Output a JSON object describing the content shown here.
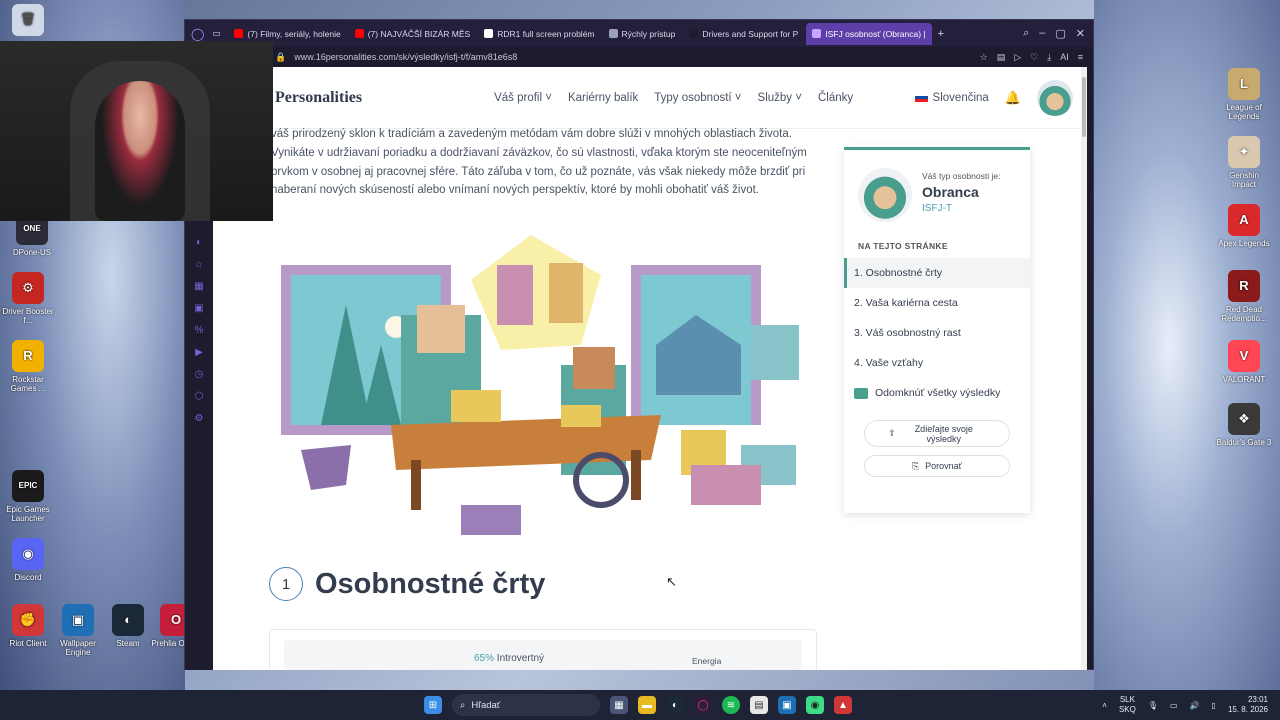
{
  "desktop": {
    "left_icons": [
      {
        "name": "DPone-US",
        "color": "#2b2b3a",
        "glyph": "ONE"
      },
      {
        "name": "Driver Booster f...",
        "color": "#c4271f",
        "glyph": "⚙"
      },
      {
        "name": "Rockstar Games ...",
        "color": "#f2b100",
        "glyph": "R"
      },
      {
        "name": "Epic Games Launcher",
        "color": "#1a1a1a",
        "glyph": "EPIC"
      },
      {
        "name": "Discord",
        "color": "#5865f2",
        "glyph": "◉"
      },
      {
        "name": "Riot Client",
        "color": "#d13639",
        "glyph": "✊"
      },
      {
        "name": "Wallpaper Engine",
        "color": "#1f6fb5",
        "glyph": "▣"
      },
      {
        "name": "Steam",
        "color": "#1b2838",
        "glyph": "◐"
      },
      {
        "name": "Prehlia Opera",
        "color": "#c41e3a",
        "glyph": "O"
      }
    ],
    "right_icons": [
      {
        "name": "League of Legends",
        "color": "#c8aa6e",
        "glyph": "L"
      },
      {
        "name": "Genshin Impact",
        "color": "#d9c7b0",
        "glyph": "✦"
      },
      {
        "name": "Apex Legends",
        "color": "#da292a",
        "glyph": "A"
      },
      {
        "name": "Red Dead Redemptio...",
        "color": "#8b1a1a",
        "glyph": "R"
      },
      {
        "name": "VALORANT",
        "color": "#ff4655",
        "glyph": "V"
      },
      {
        "name": "Baldur's Gate 3",
        "color": "#3a3a3a",
        "glyph": "❖"
      }
    ]
  },
  "browser": {
    "tabs": [
      {
        "label": "(7) Filmy, seriály, holenie",
        "fav": "#ff0000"
      },
      {
        "label": "(7) NAJVÄČŠÍ BIZÁR MĚS",
        "fav": "#ff0000"
      },
      {
        "label": "RDR1 full screen problém",
        "fav": "#ffffff"
      },
      {
        "label": "Rýchly prístup",
        "fav": "#9aa0b5"
      },
      {
        "label": "Drivers and Support for P",
        "fav": "#1d1b2e"
      },
      {
        "label": "ISFJ osobnosť (Obranca) |",
        "fav": "#c9a6ff"
      }
    ],
    "url": "www.16personalities.com/sk/výsledky/isfj-t/f/amv81e6s8"
  },
  "site": {
    "logo": "Personalities",
    "nav": [
      "Váš profil ˅",
      "Kariérny balík",
      "Typy osobností ˅",
      "Služby ˅",
      "Články"
    ],
    "language": "Slovenčina",
    "intro": "váš prirodzený sklon k tradíciám a zavedeným metódam vám dobre slúži v mnohých oblastiach života. Vynikáte v udržiavaní poriadku a dodržiavaní záväzkov, čo sú vlastnosti, vďaka ktorým ste neoceniteľným prvkom v osobnej aj pracovnej sfére. Táto záľuba v tom, čo už poznáte, vás však niekedy môže brzdiť pri naberaní nových skúseností alebo vnímaní nových perspektív, ktoré by mohli obohatiť váš život.",
    "section_number": "1",
    "section_title": "Osobnostné črty",
    "trait_pct": "65%",
    "trait_label": "Introvertný",
    "trait_category": "Energia"
  },
  "card": {
    "label": "Váš typ osobnosti je:",
    "type": "Obranca",
    "code": "ISFJ-T",
    "on_page": "NA TEJTO STRÁNKE",
    "toc": [
      "1. Osobnostné črty",
      "2. Vaša kariérna cesta",
      "3. Váš osobnostný rast",
      "4. Vaše vzťahy"
    ],
    "unlock": "Odomknúť všetky výsledky",
    "share": "Zdieľajte svoje výsledky",
    "compare": "Porovnať"
  },
  "taskbar": {
    "search": "Hľadať",
    "lang_top": "SLK",
    "lang_bottom": "SKQ",
    "time": "23:01",
    "date": "15. 8. 2026"
  }
}
